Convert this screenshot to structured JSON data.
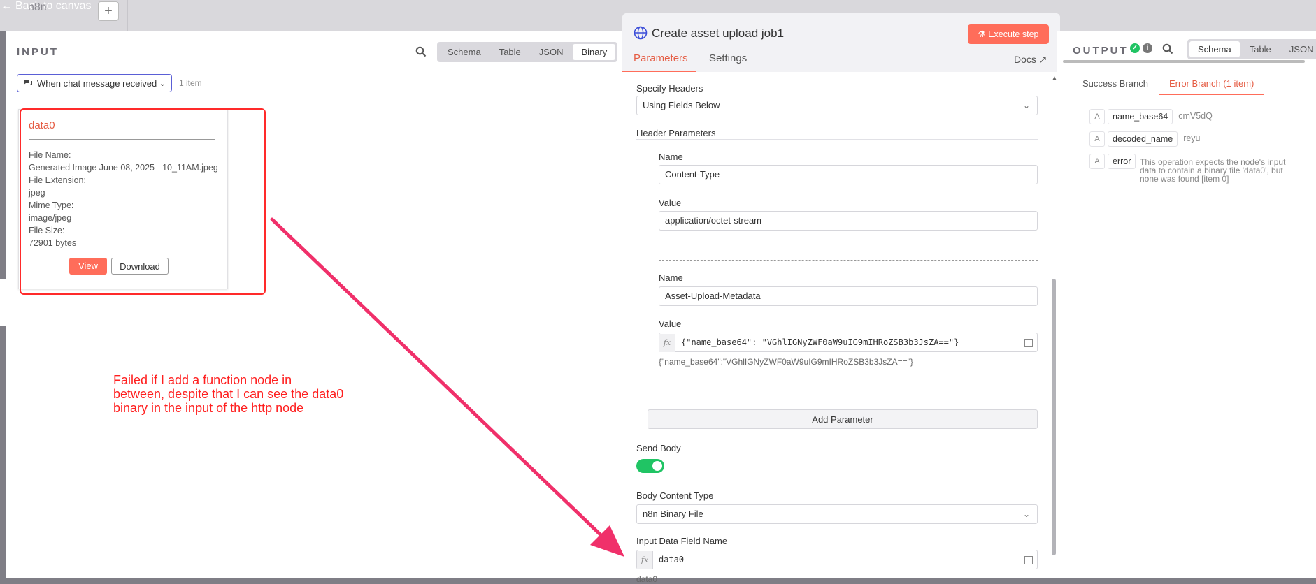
{
  "topbar": {
    "back_label": "Back to canvas",
    "app_title": "n8n",
    "add_label": "+"
  },
  "input": {
    "label": "INPUT",
    "tabs": [
      "Schema",
      "Table",
      "JSON",
      "Binary"
    ],
    "active_tab": "Binary",
    "node_select": "When chat message received",
    "item_count": "1 item",
    "binary": {
      "title": "data0",
      "file_name_label": "File Name:",
      "file_name": "Generated Image June 08, 2025 - 10_11AM.jpeg",
      "ext_label": "File Extension:",
      "ext": "jpeg",
      "mime_label": "Mime Type:",
      "mime": "image/jpeg",
      "size_label": "File Size:",
      "size": "72901 bytes",
      "view_label": "View",
      "download_label": "Download"
    }
  },
  "annotation": {
    "text": "Failed if I add a function node in between, despite that I can see the data0 binary in the input of the http node",
    "color": "#ff1f1f"
  },
  "node": {
    "title": "Create asset upload job1",
    "execute_label": "Execute step",
    "tabs": [
      "Parameters",
      "Settings"
    ],
    "active_tab": "Parameters",
    "docs_label": "Docs",
    "specify_headers_label": "Specify Headers",
    "specify_headers_value": "Using Fields Below",
    "header_params_label": "Header Parameters",
    "headers": [
      {
        "name_label": "Name",
        "name": "Content-Type",
        "value_label": "Value",
        "value": "application/octet-stream"
      },
      {
        "name_label": "Name",
        "name": "Asset-Upload-Metadata",
        "value_label": "Value",
        "value": "{\"name_base64\": \"VGhlIGNyZWF0aW9uIG9mIHRoZSB3b3JsZA==\"}",
        "preview": "{\"name_base64\":\"VGhlIGNyZWF0aW9uIG9mIHRoZSB3b3JsZA==\"}"
      }
    ],
    "add_param_label": "Add Parameter",
    "send_body_label": "Send Body",
    "send_body_on": true,
    "body_type_label": "Body Content Type",
    "body_type_value": "n8n Binary File",
    "input_field_label": "Input Data Field Name",
    "input_field_value": "data0",
    "input_field_preview": "data0",
    "accent": "#ff6d5a"
  },
  "output": {
    "label": "OUTPUT",
    "tabs": [
      "Schema",
      "Table",
      "JSON"
    ],
    "active_tab": "Schema",
    "branches": [
      "Success Branch",
      "Error Branch (1 item)"
    ],
    "active_branch": "Error Branch (1 item)",
    "rows": [
      {
        "type": "A",
        "key": "name_base64",
        "value": "cmV5dQ=="
      },
      {
        "type": "A",
        "key": "decoded_name",
        "value": "reyu"
      },
      {
        "type": "A",
        "key": "error",
        "value": "This operation expects the node's input data to contain a binary file 'data0', but none was found [item 0]"
      }
    ]
  }
}
